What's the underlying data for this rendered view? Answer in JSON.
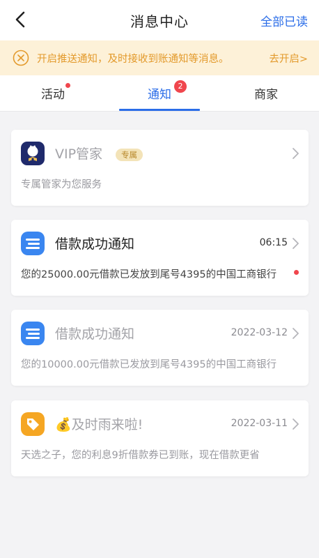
{
  "header": {
    "title": "消息中心",
    "mark_all_read": "全部已读"
  },
  "notice": {
    "text": "开启推送通知，及时接收到账通知等消息。",
    "action": "去开启>"
  },
  "tabs": [
    {
      "label": "活动",
      "has_dot": true
    },
    {
      "label": "通知",
      "badge": "2",
      "active": true
    },
    {
      "label": "商家"
    }
  ],
  "messages": [
    {
      "title": "VIP管家",
      "tag": "专属",
      "time": "",
      "desc": "专属管家为您服务",
      "icon": "vip-butler-icon",
      "unread": false
    },
    {
      "title": "借款成功通知",
      "time": "06:15",
      "desc": "您的25000.00元借款已发放到尾号4395的中国工商银行",
      "icon": "loan-notice-icon",
      "unread": true
    },
    {
      "title": "借款成功通知",
      "time": "2022-03-12",
      "desc": "您的10000.00元借款已发放到尾号4395的中国工商银行",
      "icon": "loan-notice-icon",
      "unread": false
    },
    {
      "title": "及时雨来啦!",
      "time": "2022-03-11",
      "desc": "天选之子，您的利息9折借款券已到账，现在借款更省",
      "icon": "coupon-tag-icon",
      "title_icon": "money-bag-icon",
      "unread": false
    }
  ],
  "colors": {
    "accent": "#2b6de8",
    "notice_bg": "#fdf1d8",
    "notice_text": "#e39a2c",
    "badge": "#f0464d"
  }
}
